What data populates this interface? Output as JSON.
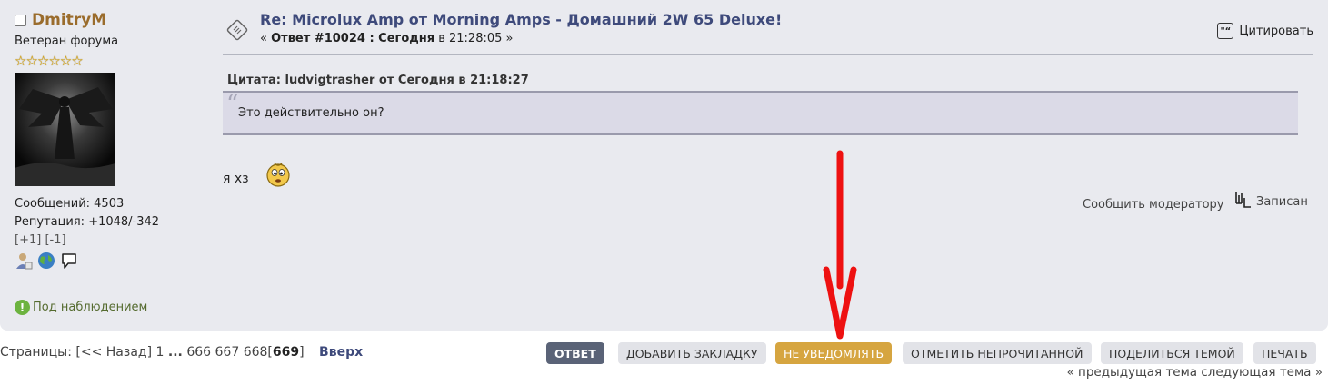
{
  "poster": {
    "name": "DmitryM",
    "rank": "Ветеран форума",
    "stars": "☆☆☆☆☆☆",
    "posts": "Сообщений: 4503",
    "reputation": "Репутация: +1048/-342",
    "karma_plus": "[+1]",
    "karma_minus": "[-1]",
    "watch_label": "Под наблюдением"
  },
  "post": {
    "subject": "Re: Microlux Amp от Morning Amps - Домашний 2W 65 Deluxe!",
    "meta_prefix": "«",
    "meta_reply": "Ответ #10024 : Сегодня",
    "meta_time": "в 21:28:05",
    "meta_suffix": "»",
    "quote_button": "Цитировать",
    "quote_header": "Цитата: ludvigtrasher от Сегодня в 21:18:27",
    "quote_text": "Это действительно он?",
    "message": "я хз",
    "report": "Сообщить модератору",
    "logged": "Записан"
  },
  "pagination": {
    "label": "Страницы:",
    "prev": "[<< Назад]",
    "p1": "1",
    "ellipsis": "...",
    "p666": "666",
    "p667": "667",
    "p668": "668",
    "current_open": "[",
    "current": "669",
    "current_close": "]",
    "top": "Вверх"
  },
  "buttons": {
    "reply": "ОТВЕТ",
    "bookmark": "ДОБАВИТЬ ЗАКЛАДКУ",
    "notify": "НЕ УВЕДОМЛЯТЬ",
    "mark_unread": "ОТМЕТИТЬ НЕПРОЧИТАННОЙ",
    "share": "ПОДЕЛИТЬСЯ ТЕМОЙ",
    "print": "ПЕЧАТЬ"
  },
  "topic_nav": {
    "prev": "« предыдущая тема",
    "next": "следующая тема »"
  },
  "colors": {
    "post_bg": "#e9eaef",
    "name": "#9a6c2c",
    "subject": "#3e4a7b",
    "reply_btn": "#5a6377",
    "notify_btn": "#d6a540",
    "arrow": "#ee1111"
  }
}
